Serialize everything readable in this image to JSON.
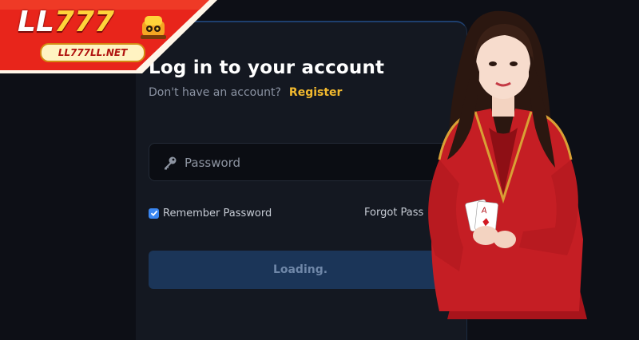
{
  "brand": {
    "logo_main": "LL",
    "logo_numbers": "777",
    "domain": "LL777LL.NET"
  },
  "login": {
    "title": "Log in to your account",
    "no_account_text": "Don't have an account?",
    "register_label": "Register",
    "password_placeholder": "Password",
    "remember_label": "Remember Password",
    "remember_checked": true,
    "forgot_label": "Forgot Pass",
    "submit_label": "Loading."
  },
  "icons": {
    "password": "key-icon",
    "remember": "check-icon",
    "mascot": "mascot-icon"
  },
  "colors": {
    "background": "#0d0f16",
    "panel": "#141821",
    "accent_link": "#f2b92e",
    "checkbox": "#3a86f0",
    "button": "#1b3558",
    "banner_red": "#e8251b"
  }
}
